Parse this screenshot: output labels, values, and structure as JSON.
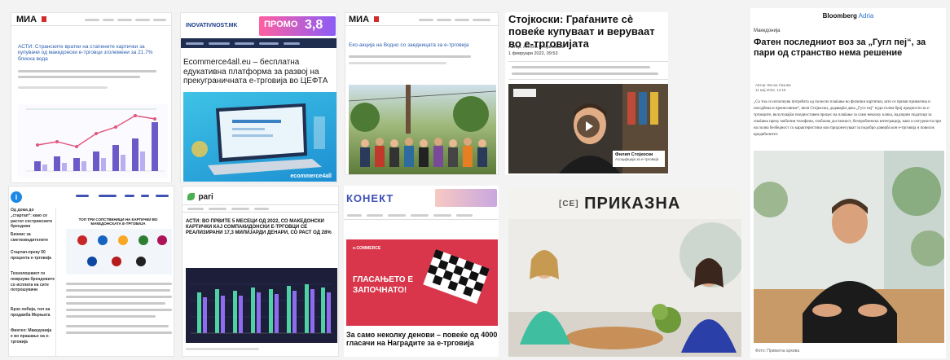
{
  "tiles": {
    "mia1": {
      "logo": "МИА",
      "headline": "АСТИ: Странските вратки на стапените картички за купувачи од македонски е-трговци зголемени за 21.7% блиска вода"
    },
    "inovativnost": {
      "logo": "INOVATIVNOST.MK",
      "promo": "ПРОМО",
      "promo_value": "3,8",
      "headline": "Ecommerce4all.eu – бесплатна едукативна платформа за развој на прекуграничната е-трговија во ЦЕФТА",
      "screen_brand": "ecommerce4all"
    },
    "mia2": {
      "logo": "МИА",
      "headline": "Еко-акција на Водно со заедницата за е-трговија"
    },
    "stojkoski": {
      "headline": "Стојкоски: Граѓаните сè повеќе купуваат и веруваат во е-трговијата",
      "author": "Автор: Ангела Стојановска",
      "date": "1 февруари 2022, 09:53",
      "caption_name": "Филип Стојкоски",
      "caption_role": "Асоцијација за е-трговија"
    },
    "bloomberg": {
      "logo": "Bloomberg",
      "logo_accent": "Adria",
      "section": "Македонија",
      "headline": "Фатен последниот воз за „Гугл пеј“, за пари од странство нема решение",
      "author": "Автор: Весна Лазова",
      "date": "11 мај 2022, 12:15",
      "body": "„Со тоа се исполнува потребата од полесно плаќање во физички картички, што се прими привлечна и погодбена и пренесовние“, вели Стојкоски, додавајќи дека „Гугл пеј“ нуди голем број предности за е-трговците, вклучувајќи поедноставен процес на плаќање за само неколку клика, надзорни податоци за плаќање преку мобилни телефони, глобална достапност, безпроблемска интеграција, како и сигурноста при на полна безбедност со карактеристики кои придонесуваат за подобро доверба кон е-трговија и повисок кредибилитет.",
      "photo_credit": "Фото: Приватна архива"
    },
    "blue_site": {
      "logo": "i",
      "headline": "ТОП ТРИ СОПСТВЕНИЦИ НА КАРТИЧКИ ВО МАКЕДОНСКАТА Е-ТРГОВИЈА",
      "side_items": [
        "Од дома до „стартап“: како се растат сестринските брендови",
        "Бизнис за сметководителите",
        "Стартап-преку 50 процента е-трговија",
        "Технолошкиот ги поврзува брендовите со исплата на сите потрошувачи",
        "Брзо лобија, топ на продажба Мерњата",
        "Финтех: Македонија е во прашање на е-трговија"
      ]
    },
    "pari": {
      "logo": "pari",
      "headline": "АСТИ: ВО ПРВИТЕ 5 МЕСЕЦИ ОД 2022, СО МАКЕДОНСКИ КАРТИЧКИ КАЈ СОМПАКИДОНСКИ Е-ТРГОВЦИ СЕ РЕАЛИЗИРАНИ 17,3 МИЛИЈАРДИ ДЕНАРИ, СО РАСТ ОД 28%"
    },
    "konekt": {
      "logo": "КОНЕКТ",
      "banner_text": "ГЛАСАЊЕТО Е ЗАПОЧНАТО!",
      "banner_brand": "е-COMMERCE",
      "headline": "За само неколку денови – повеќе од 4000 гласачи на Наградите за е-трговија"
    },
    "prikazna": {
      "logo": "ПРИКАЗНА",
      "logo_prefix": "[СЕ]"
    }
  }
}
